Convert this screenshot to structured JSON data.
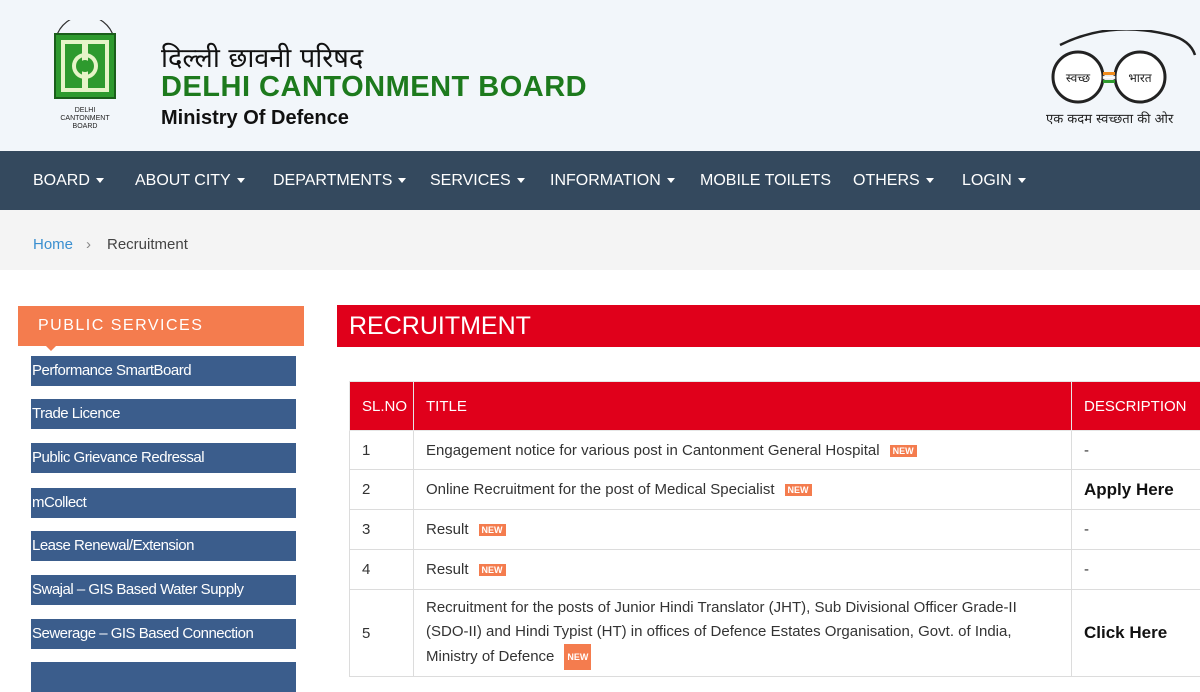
{
  "header": {
    "hindi_title": "दिल्ली छावनी परिषद",
    "title": "DELHI CANTONMENT BOARD",
    "subtitle": "Ministry Of Defence",
    "logo_text": "DELHI CANTONMENT BOARD",
    "swachh_left": "स्वच्छ",
    "swachh_right": "भारत",
    "swachh_tagline": "एक कदम स्वच्छता की ओर",
    "brand_color": "#1d7a1d"
  },
  "nav": {
    "items": [
      {
        "label": "BOARD",
        "dropdown": true
      },
      {
        "label": "ABOUT CITY",
        "dropdown": true
      },
      {
        "label": "DEPARTMENTS",
        "dropdown": true
      },
      {
        "label": "SERVICES",
        "dropdown": true
      },
      {
        "label": "INFORMATION",
        "dropdown": true
      },
      {
        "label": "MOBILE TOILETS",
        "dropdown": false
      },
      {
        "label": "OTHERS",
        "dropdown": true
      },
      {
        "label": "LOGIN",
        "dropdown": true
      }
    ],
    "bg_color": "#34495e"
  },
  "breadcrumb": {
    "home": "Home",
    "separator": "›",
    "current": "Recruitment"
  },
  "public_services": {
    "heading": "PUBLIC SERVICES",
    "items": [
      "Performance SmartBoard",
      "Trade Licence",
      "Public Grievance Redressal",
      "mCollect",
      "Lease Renewal/Extension",
      "Swajal – GIS Based Water Supply",
      "Sewerage – GIS Based Connection"
    ],
    "heading_color": "#f47c4e",
    "item_color": "#3b5d8c"
  },
  "recruitment": {
    "heading": "RECRUITMENT",
    "accent_color": "#e0001b",
    "columns": [
      "SL.NO",
      "TITLE",
      "DESCRIPTION"
    ],
    "new_badge": "NEW",
    "rows": [
      {
        "sl": "1",
        "title": "Engagement notice for various post in Cantonment General Hospital",
        "desc": "-"
      },
      {
        "sl": "2",
        "title": "Online Recruitment for the post of Medical Specialist",
        "desc": "Apply Here"
      },
      {
        "sl": "3",
        "title": "Result",
        "desc": "-"
      },
      {
        "sl": "4",
        "title": "Result",
        "desc": "-"
      },
      {
        "sl": "5",
        "title": "Recruitment for the posts of Junior Hindi Translator (JHT), Sub Divisional Officer Grade-II (SDO-II) and Hindi Typist (HT) in offices of Defence Estates Organisation, Govt. of India, Ministry of Defence",
        "desc": "Click Here"
      }
    ]
  }
}
